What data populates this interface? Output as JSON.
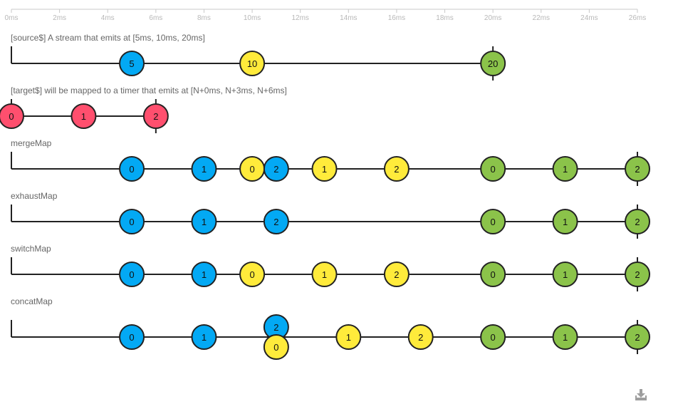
{
  "timeline": {
    "ticks": [
      "0ms",
      "2ms",
      "4ms",
      "6ms",
      "8ms",
      "10ms",
      "12ms",
      "14ms",
      "16ms",
      "18ms",
      "20ms",
      "22ms",
      "24ms",
      "26ms"
    ],
    "max_ms": 26
  },
  "colors": {
    "blue": "#03a9f4",
    "yellow": "#ffeb3b",
    "green": "#8bc34a",
    "red": "#ff4f6e",
    "line": "#222222",
    "axis": "#c8c8c8"
  },
  "rows": [
    {
      "id": "source",
      "label": "[source$] A stream that emits at [5ms, 10ms, 20ms]",
      "complete_ms": 20,
      "marbles": [
        {
          "t": 5,
          "text": "5",
          "color": "blue"
        },
        {
          "t": 10,
          "text": "10",
          "color": "yellow"
        },
        {
          "t": 20,
          "text": "20",
          "color": "green"
        }
      ]
    },
    {
      "id": "target",
      "label": "[target$] will be mapped to a timer that emits at [N+0ms, N+3ms, N+6ms]",
      "complete_ms": 6,
      "marbles": [
        {
          "t": 0,
          "text": "0",
          "color": "red"
        },
        {
          "t": 3,
          "text": "1",
          "color": "red"
        },
        {
          "t": 6,
          "text": "2",
          "color": "red"
        }
      ]
    },
    {
      "id": "mergeMap",
      "label": "mergeMap",
      "complete_ms": 26,
      "marbles": [
        {
          "t": 5,
          "text": "0",
          "color": "blue"
        },
        {
          "t": 8,
          "text": "1",
          "color": "blue"
        },
        {
          "t": 10,
          "text": "0",
          "color": "yellow"
        },
        {
          "t": 11,
          "text": "2",
          "color": "blue"
        },
        {
          "t": 13,
          "text": "1",
          "color": "yellow"
        },
        {
          "t": 16,
          "text": "2",
          "color": "yellow"
        },
        {
          "t": 20,
          "text": "0",
          "color": "green"
        },
        {
          "t": 23,
          "text": "1",
          "color": "green"
        },
        {
          "t": 26,
          "text": "2",
          "color": "green"
        }
      ]
    },
    {
      "id": "exhaustMap",
      "label": "exhaustMap",
      "complete_ms": 26,
      "marbles": [
        {
          "t": 5,
          "text": "0",
          "color": "blue"
        },
        {
          "t": 8,
          "text": "1",
          "color": "blue"
        },
        {
          "t": 11,
          "text": "2",
          "color": "blue"
        },
        {
          "t": 20,
          "text": "0",
          "color": "green"
        },
        {
          "t": 23,
          "text": "1",
          "color": "green"
        },
        {
          "t": 26,
          "text": "2",
          "color": "green"
        }
      ]
    },
    {
      "id": "switchMap",
      "label": "switchMap",
      "complete_ms": 26,
      "marbles": [
        {
          "t": 5,
          "text": "0",
          "color": "blue"
        },
        {
          "t": 8,
          "text": "1",
          "color": "blue"
        },
        {
          "t": 10,
          "text": "0",
          "color": "yellow"
        },
        {
          "t": 13,
          "text": "1",
          "color": "yellow"
        },
        {
          "t": 16,
          "text": "2",
          "color": "yellow"
        },
        {
          "t": 20,
          "text": "0",
          "color": "green"
        },
        {
          "t": 23,
          "text": "1",
          "color": "green"
        },
        {
          "t": 26,
          "text": "2",
          "color": "green"
        }
      ]
    },
    {
      "id": "concatMap",
      "label": "concatMap",
      "complete_ms": 26,
      "marbles": [
        {
          "t": 5,
          "text": "0",
          "color": "blue"
        },
        {
          "t": 8,
          "text": "1",
          "color": "blue"
        },
        {
          "t": 11,
          "text": "2",
          "color": "blue",
          "stack": "upper"
        },
        {
          "t": 11,
          "text": "0",
          "color": "yellow",
          "stack": "lower"
        },
        {
          "t": 14,
          "text": "1",
          "color": "yellow"
        },
        {
          "t": 17,
          "text": "2",
          "color": "yellow"
        },
        {
          "t": 20,
          "text": "0",
          "color": "green"
        },
        {
          "t": 23,
          "text": "1",
          "color": "green"
        },
        {
          "t": 26,
          "text": "2",
          "color": "green"
        }
      ]
    }
  ],
  "download": {
    "icon": "download-icon"
  }
}
